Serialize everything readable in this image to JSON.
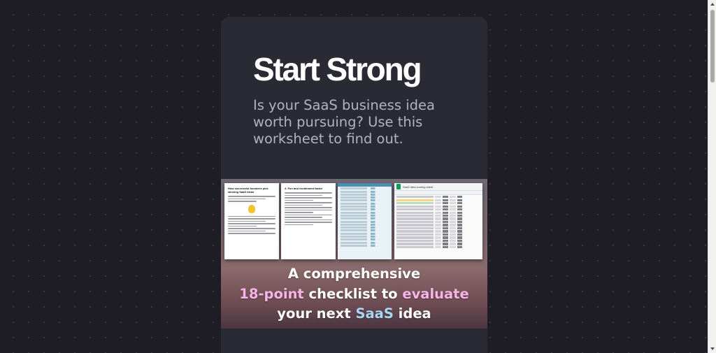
{
  "hero": {
    "title": "Start Strong",
    "subtitle": "Is your SaaS business idea worth pursuing? Use this worksheet to find out."
  },
  "banner": {
    "line1": "A comprehensive",
    "line2_highlight": "18-point",
    "line2_text": " checklist to ",
    "line2_highlight2": "evaluate",
    "line3_text": "your next ",
    "line3_highlight": "SaaS",
    "line3_text2": " idea",
    "doc1_title": "How successful founders pick winning SaaS ideas",
    "doc2_title": "4. Fun and excitement factor",
    "doc4_title": "SaaS idea scoring sheet",
    "colors": {
      "pink": "#f7b4e6",
      "blue": "#a8d6f3",
      "bulb": "#f2c12e"
    }
  },
  "icons": {
    "sheets": "google-sheets-icon",
    "bulb": "lightbulb-icon"
  }
}
